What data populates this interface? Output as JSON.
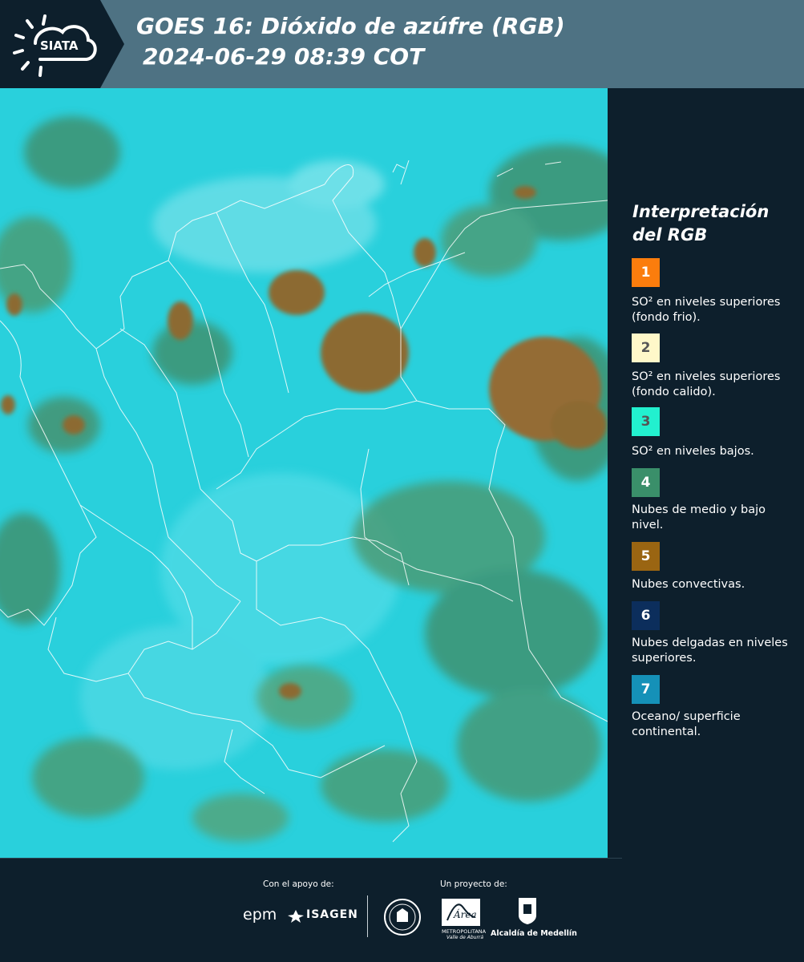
{
  "header": {
    "brand": "SIATA",
    "title_line1": "GOES 16: Dióxido de azúfre (RGB)",
    "title_line2": "2024-06-29 08:39 COT"
  },
  "colors": {
    "header_bg": "#4e7283",
    "panel_bg": "#0d1f2c",
    "map_base": "#29d0dc",
    "cloud_green": "#3f8e6b",
    "convective": "#9a7035"
  },
  "legend": {
    "title": "Interpretación del RGB",
    "items": [
      {
        "number": "1",
        "label": "SO² en niveles superiores (fondo frio).",
        "color": "#fb7d0d",
        "text_color": "#ffffff"
      },
      {
        "number": "2",
        "label": "SO² en niveles superiores (fondo calido).",
        "color": "#fff8c9",
        "text_color": "#555555"
      },
      {
        "number": "3",
        "label": "SO² en niveles bajos.",
        "color": "#22f0cf",
        "text_color": "#555555"
      },
      {
        "number": "4",
        "label": "Nubes de medio y bajo nivel.",
        "color": "#3a8f6a",
        "text_color": "#ffffff"
      },
      {
        "number": "5",
        "label": "Nubes convectivas.",
        "color": "#9a6512",
        "text_color": "#ffffff"
      },
      {
        "number": "6",
        "label": "Nubes delgadas en niveles superiores.",
        "color": "#0c2e5c",
        "text_color": "#ffffff"
      },
      {
        "number": "7",
        "label": "Oceano/ superficie continental.",
        "color": "#1591b8",
        "text_color": "#ffffff"
      }
    ]
  },
  "footer": {
    "support_label": "Con el apoyo de:",
    "project_label": "Un proyecto de:",
    "sponsor1": "epm",
    "sponsor2": "ISAGEN",
    "partner1_line1": "Área",
    "partner1_line2": "METROPOLITANA",
    "partner1_line3": "Valle de Aburrá",
    "partner2": "Alcaldía de Medellín"
  }
}
